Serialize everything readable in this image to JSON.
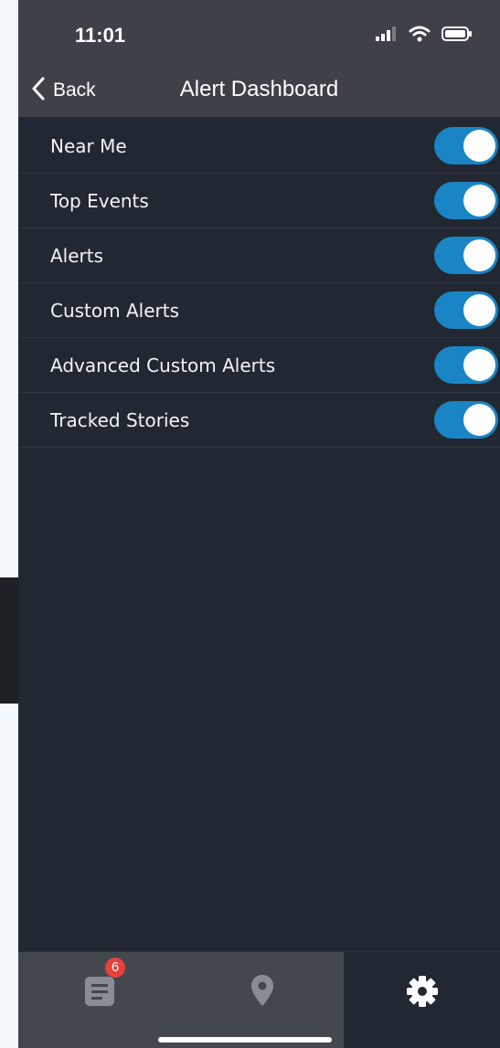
{
  "status_bar": {
    "time": "11:01",
    "icons": [
      "signal-icon",
      "wifi-icon",
      "battery-icon"
    ]
  },
  "nav": {
    "back_label": "Back",
    "title": "Alert Dashboard"
  },
  "settings": [
    {
      "label": "Near Me",
      "enabled": true
    },
    {
      "label": "Top Events",
      "enabled": true
    },
    {
      "label": "Alerts",
      "enabled": true
    },
    {
      "label": "Custom Alerts",
      "enabled": true
    },
    {
      "label": "Advanced Custom Alerts",
      "enabled": true
    },
    {
      "label": "Tracked Stories",
      "enabled": true
    }
  ],
  "tab_bar": {
    "tabs": [
      {
        "name": "news-tab",
        "icon": "news-icon",
        "badge": "6",
        "active": false
      },
      {
        "name": "map-tab",
        "icon": "map-pin-icon",
        "active": false
      },
      {
        "name": "settings-tab",
        "icon": "gear-icon",
        "active": true
      }
    ]
  },
  "colors": {
    "accent": "#1a85c5",
    "background": "#222831",
    "bar": "#3e4248",
    "badge": "#e8403a"
  }
}
